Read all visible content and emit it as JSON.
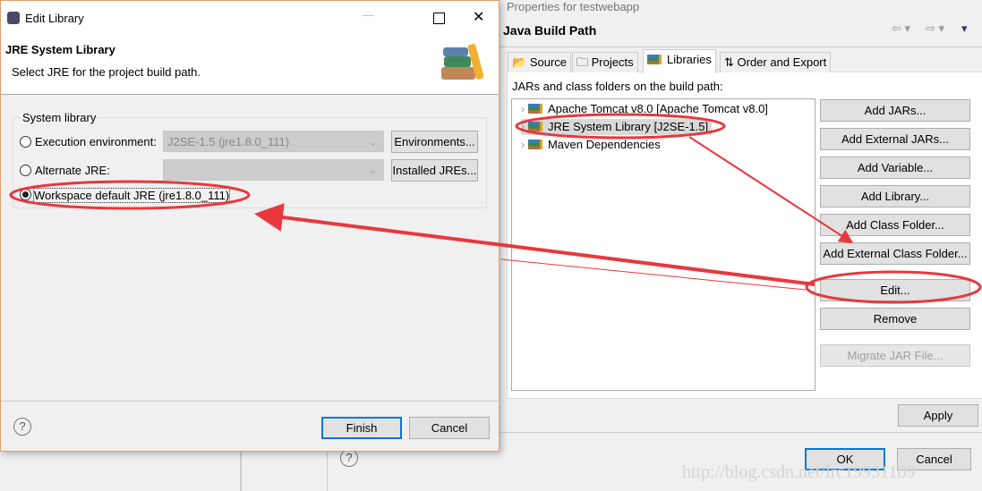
{
  "background_window": {
    "title": "Properties for testwebapp",
    "section_title": "Java Build Path",
    "tabs": [
      {
        "label": "Source"
      },
      {
        "label": "Projects"
      },
      {
        "label": "Libraries",
        "active": true
      },
      {
        "label": "Order and Export"
      }
    ],
    "list_label": "JARs and class folders on the build path:",
    "tree": [
      {
        "label": "Apache Tomcat v8.0 [Apache Tomcat v8.0]"
      },
      {
        "label": "JRE System Library [J2SE-1.5]",
        "selected": true
      },
      {
        "label": "Maven Dependencies"
      }
    ],
    "buttons": {
      "add_jars": "Add JARs...",
      "add_external_jars": "Add External JARs...",
      "add_variable": "Add Variable...",
      "add_library": "Add Library...",
      "add_class_folder": "Add Class Folder...",
      "add_external_class_folder": "Add External Class Folder...",
      "edit": "Edit...",
      "remove": "Remove",
      "migrate": "Migrate JAR File...",
      "apply": "Apply",
      "ok": "OK",
      "cancel": "Cancel"
    },
    "watermark": "http://blog.csdn.net/lrc19931109"
  },
  "dialog": {
    "title": "Edit Library",
    "heading": "JRE System Library",
    "description": "Select JRE for the project build path.",
    "group_label": "System library",
    "options": [
      {
        "label": "Execution environment:",
        "value": "J2SE-1.5 (jre1.8.0_111)",
        "button": "Environments..."
      },
      {
        "label": "Alternate JRE:",
        "value": "",
        "button": "Installed JREs..."
      },
      {
        "label": "Workspace default JRE (jre1.8.0_111)",
        "selected": true
      }
    ],
    "finish": "Finish",
    "cancel": "Cancel"
  },
  "annotation_color": "#e8383d"
}
